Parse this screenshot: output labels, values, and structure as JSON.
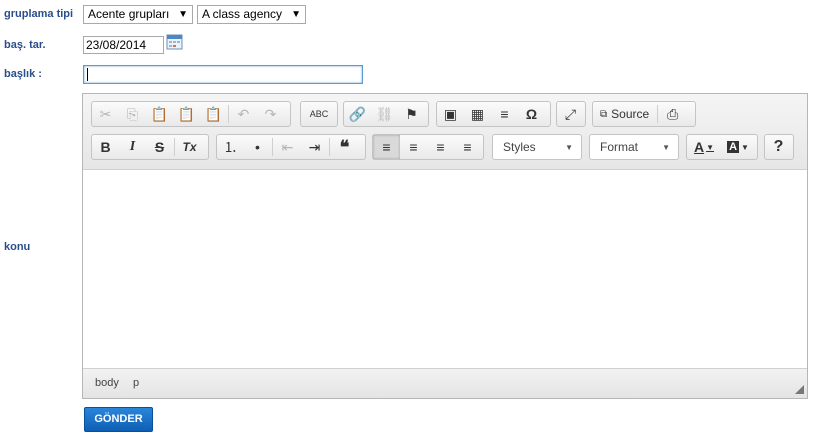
{
  "form": {
    "group_type_label": "gruplama tipi",
    "group_select_value": "Acente grupları",
    "agency_select_value": "A class agency",
    "start_date_label": "baş. tar.",
    "start_date_value": "23/08/2014",
    "title_label": "başlık :",
    "title_value": "",
    "subject_label": "konu",
    "submit_label": "GÖNDER"
  },
  "editor": {
    "source_label": "Source",
    "styles_label": "Styles",
    "format_label": "Format",
    "path": [
      "body",
      "p"
    ],
    "icons": {
      "cut": "✂",
      "copy": "⎘",
      "paste": "📋",
      "undo": "↶",
      "redo": "↷",
      "spellcheck": "ABC",
      "link": "🔗",
      "unlink": "⛓",
      "anchor": "⚑",
      "image": "▣",
      "table": "▦",
      "hr": "≡",
      "special": "Ω",
      "maximize": "⤢",
      "bold": "B",
      "italic": "I",
      "strike": "S",
      "removeformat": "Tx",
      "numlist": "⒈",
      "bullist": "•",
      "outdent": "⇤",
      "indent": "⇥",
      "blockquote": "❝",
      "align_left": "≡",
      "align_center": "≡",
      "align_right": "≡",
      "justify": "≡",
      "textcolor": "A",
      "bgcolor": "A",
      "help": "?"
    }
  }
}
